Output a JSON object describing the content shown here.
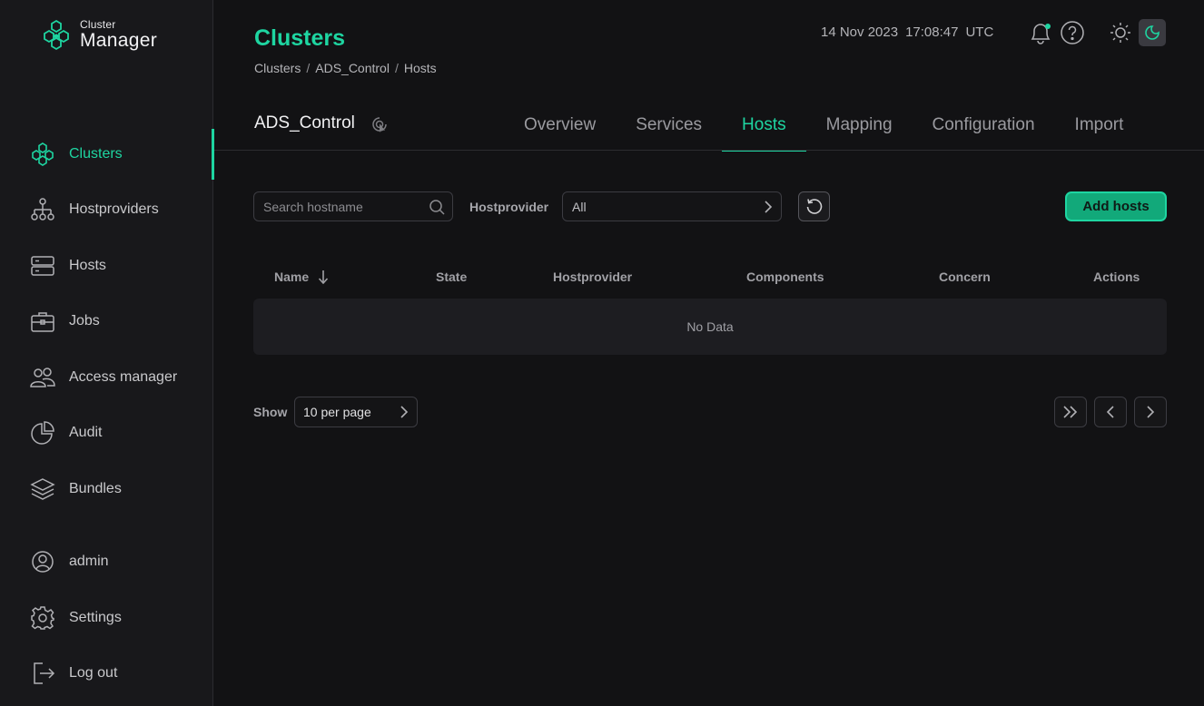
{
  "app": {
    "logo_small": "Cluster",
    "logo_big": "Manager"
  },
  "sidebar": {
    "items": [
      {
        "label": "Clusters",
        "icon": "clusters-icon",
        "active": true
      },
      {
        "label": "Hostproviders",
        "icon": "hostproviders-icon"
      },
      {
        "label": "Hosts",
        "icon": "hosts-icon"
      },
      {
        "label": "Jobs",
        "icon": "jobs-icon"
      },
      {
        "label": "Access manager",
        "icon": "access-manager-icon"
      },
      {
        "label": "Audit",
        "icon": "audit-icon"
      },
      {
        "label": "Bundles",
        "icon": "bundles-icon"
      }
    ],
    "bottom": [
      {
        "label": "admin",
        "icon": "user-icon"
      },
      {
        "label": "Settings",
        "icon": "gear-icon"
      },
      {
        "label": "Log out",
        "icon": "logout-icon"
      }
    ]
  },
  "header": {
    "title": "Clusters",
    "breadcrumb": [
      "Clusters",
      "ADS_Control",
      "Hosts"
    ],
    "date": "14 Nov 2023",
    "time": "17:08:47",
    "timezone": "UTC"
  },
  "cluster": {
    "name": "ADS_Control"
  },
  "tabs": [
    {
      "label": "Overview"
    },
    {
      "label": "Services"
    },
    {
      "label": "Hosts",
      "active": true
    },
    {
      "label": "Mapping"
    },
    {
      "label": "Configuration"
    },
    {
      "label": "Import"
    }
  ],
  "toolbar": {
    "search_placeholder": "Search hostname",
    "filter_label": "Hostprovider",
    "filter_value": "All",
    "add_label": "Add hosts"
  },
  "table": {
    "columns": [
      "Name",
      "State",
      "Hostprovider",
      "Components",
      "Concern",
      "Actions"
    ],
    "empty_text": "No Data"
  },
  "pagination": {
    "show_label": "Show",
    "per_page": "10 per page"
  },
  "colors": {
    "accent": "#1ed5a1",
    "background": "#121214",
    "sidebar": "#18181b"
  }
}
